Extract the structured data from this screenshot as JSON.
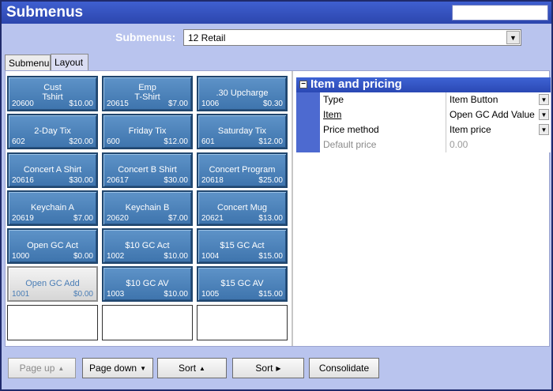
{
  "window": {
    "title": "Submenus"
  },
  "submenu": {
    "label": "Submenus:",
    "selected": "12 Retail"
  },
  "tabs": [
    {
      "label": "Submenu",
      "active": false
    },
    {
      "label": "Layout",
      "active": true
    }
  ],
  "buttons": [
    {
      "label": "Cust\nTshirt",
      "num": "20600",
      "price": "$10.00",
      "state": "normal"
    },
    {
      "label": "Emp\nT-Shirt",
      "num": "20615",
      "price": "$7.00",
      "state": "normal"
    },
    {
      "label": ".30 Upcharge",
      "num": "1006",
      "price": "$0.30",
      "state": "normal"
    },
    {
      "label": "2-Day Tix",
      "num": "602",
      "price": "$20.00",
      "state": "normal"
    },
    {
      "label": "Friday Tix",
      "num": "600",
      "price": "$12.00",
      "state": "normal"
    },
    {
      "label": "Saturday Tix",
      "num": "601",
      "price": "$12.00",
      "state": "normal"
    },
    {
      "label": "Concert A Shirt",
      "num": "20616",
      "price": "$30.00",
      "state": "normal"
    },
    {
      "label": "Concert B Shirt",
      "num": "20617",
      "price": "$30.00",
      "state": "normal"
    },
    {
      "label": "Concert Program",
      "num": "20618",
      "price": "$25.00",
      "state": "normal"
    },
    {
      "label": "Keychain A",
      "num": "20619",
      "price": "$7.00",
      "state": "normal"
    },
    {
      "label": "Keychain B",
      "num": "20620",
      "price": "$7.00",
      "state": "normal"
    },
    {
      "label": "Concert Mug",
      "num": "20621",
      "price": "$13.00",
      "state": "normal"
    },
    {
      "label": "Open GC Act",
      "num": "1000",
      "price": "$0.00",
      "state": "normal"
    },
    {
      "label": "$10 GC Act",
      "num": "1002",
      "price": "$10.00",
      "state": "normal"
    },
    {
      "label": "$15 GC Act",
      "num": "1004",
      "price": "$15.00",
      "state": "normal"
    },
    {
      "label": "Open GC Add",
      "num": "1001",
      "price": "$0.00",
      "state": "selected"
    },
    {
      "label": "$10 GC AV",
      "num": "1003",
      "price": "$10.00",
      "state": "normal"
    },
    {
      "label": "$15 GC AV",
      "num": "1005",
      "price": "$15.00",
      "state": "normal"
    },
    {
      "label": "",
      "num": "",
      "price": "",
      "state": "empty"
    },
    {
      "label": "",
      "num": "",
      "price": "",
      "state": "empty"
    },
    {
      "label": "",
      "num": "",
      "price": "",
      "state": "empty"
    }
  ],
  "properties": {
    "section_title": "Item and pricing",
    "collapse_glyph": "−",
    "rows": [
      {
        "name": "Type",
        "value": "Item Button",
        "link": false,
        "disabled": false,
        "dropdown": true
      },
      {
        "name": "Item",
        "value": "Open GC Add Value",
        "link": true,
        "disabled": false,
        "dropdown": true
      },
      {
        "name": "Price method",
        "value": "Item price",
        "link": false,
        "disabled": false,
        "dropdown": true
      },
      {
        "name": "Default price",
        "value": "0.00",
        "link": false,
        "disabled": true,
        "dropdown": false
      }
    ]
  },
  "toolbar": {
    "page_up": "Page up",
    "page_down": "Page down",
    "sort_up": "Sort",
    "sort_right": "Sort",
    "consolidate": "Consolidate"
  },
  "icons": {
    "dropdown": "▼",
    "up": "▲",
    "down": "▼",
    "right": "▶"
  }
}
